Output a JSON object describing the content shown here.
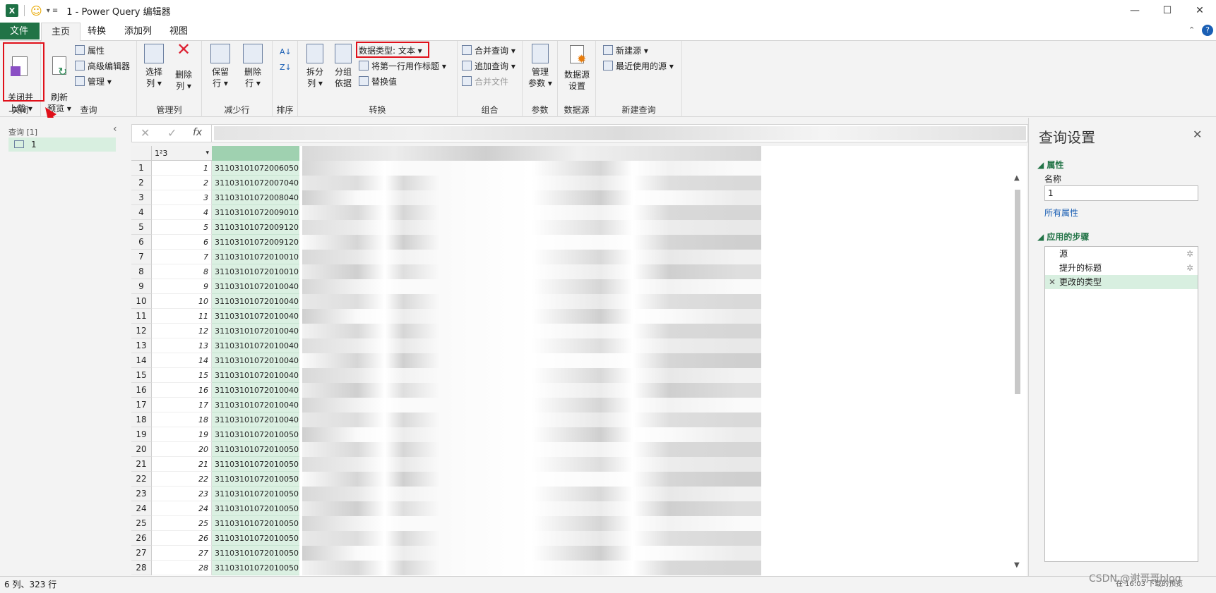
{
  "window": {
    "title": "1 - Power Query 编辑器",
    "minimize": "—",
    "maximize": "☐",
    "close": "✕"
  },
  "tabs": [
    "文件",
    "主页",
    "转换",
    "添加列",
    "视图"
  ],
  "ribbon": {
    "close": {
      "btn": "关闭并\n上载 ▾",
      "group": "关闭"
    },
    "query": {
      "refresh": "刷新\n预览 ▾",
      "props": "属性",
      "adv": "高级编辑器",
      "manage": "管理 ▾",
      "group": "查询"
    },
    "cols": {
      "choose": "选择\n列 ▾",
      "remove": "删除\n列 ▾",
      "group": "管理列"
    },
    "rows": {
      "keep": "保留\n行 ▾",
      "remove": "删除\n行 ▾",
      "group": "减少行"
    },
    "sort": {
      "group": "排序"
    },
    "transform": {
      "split": "拆分\n列 ▾",
      "groupby": "分组\n依据",
      "dtype": "数据类型: 文本 ▾",
      "firstrow": "将第一行用作标题 ▾",
      "replace": "替换值",
      "group": "转换"
    },
    "combine": {
      "merge": "合并查询 ▾",
      "append": "追加查询 ▾",
      "files": "合并文件",
      "group": "组合"
    },
    "params": {
      "manage": "管理\n参数 ▾",
      "group": "参数"
    },
    "ds": {
      "settings": "数据源\n设置",
      "group": "数据源"
    },
    "newq": {
      "new": "新建源 ▾",
      "recent": "最近使用的源 ▾",
      "group": "新建查询"
    }
  },
  "queries": {
    "header": "查询 [1]",
    "item": "1"
  },
  "formula": {
    "x": "✕",
    "check": "✓",
    "fx": "fx"
  },
  "grid": {
    "col1_type": "1²3",
    "rows": [
      [
        "1",
        "1",
        "31103101072006050..."
      ],
      [
        "2",
        "2",
        "31103101072007040..."
      ],
      [
        "3",
        "3",
        "31103101072008040..."
      ],
      [
        "4",
        "4",
        "31103101072009010..."
      ],
      [
        "5",
        "5",
        "31103101072009120..."
      ],
      [
        "6",
        "6",
        "31103101072009120..."
      ],
      [
        "7",
        "7",
        "31103101072010010..."
      ],
      [
        "8",
        "8",
        "31103101072010010..."
      ],
      [
        "9",
        "9",
        "31103101072010040..."
      ],
      [
        "10",
        "10",
        "31103101072010040..."
      ],
      [
        "11",
        "11",
        "31103101072010040..."
      ],
      [
        "12",
        "12",
        "31103101072010040..."
      ],
      [
        "13",
        "13",
        "31103101072010040..."
      ],
      [
        "14",
        "14",
        "31103101072010040..."
      ],
      [
        "15",
        "15",
        "31103101072010040..."
      ],
      [
        "16",
        "16",
        "31103101072010040..."
      ],
      [
        "17",
        "17",
        "31103101072010040..."
      ],
      [
        "18",
        "18",
        "31103101072010040..."
      ],
      [
        "19",
        "19",
        "31103101072010050..."
      ],
      [
        "20",
        "20",
        "31103101072010050..."
      ],
      [
        "21",
        "21",
        "31103101072010050..."
      ],
      [
        "22",
        "22",
        "31103101072010050..."
      ],
      [
        "23",
        "23",
        "31103101072010050..."
      ],
      [
        "24",
        "24",
        "31103101072010050..."
      ],
      [
        "25",
        "25",
        "31103101072010050..."
      ],
      [
        "26",
        "26",
        "31103101072010050..."
      ],
      [
        "27",
        "27",
        "31103101072010050..."
      ],
      [
        "28",
        "28",
        "31103101072010050..."
      ]
    ]
  },
  "settings": {
    "title": "查询设置",
    "props": "属性",
    "name_label": "名称",
    "name_value": "1",
    "all_props": "所有属性",
    "steps_label": "应用的步骤",
    "steps": [
      "源",
      "提升的标题",
      "更改的类型"
    ]
  },
  "status": {
    "left": "6 列、323 行",
    "right": "在 16:03 下载的预览",
    "watermark": "CSDN @谢哥哥blog"
  }
}
